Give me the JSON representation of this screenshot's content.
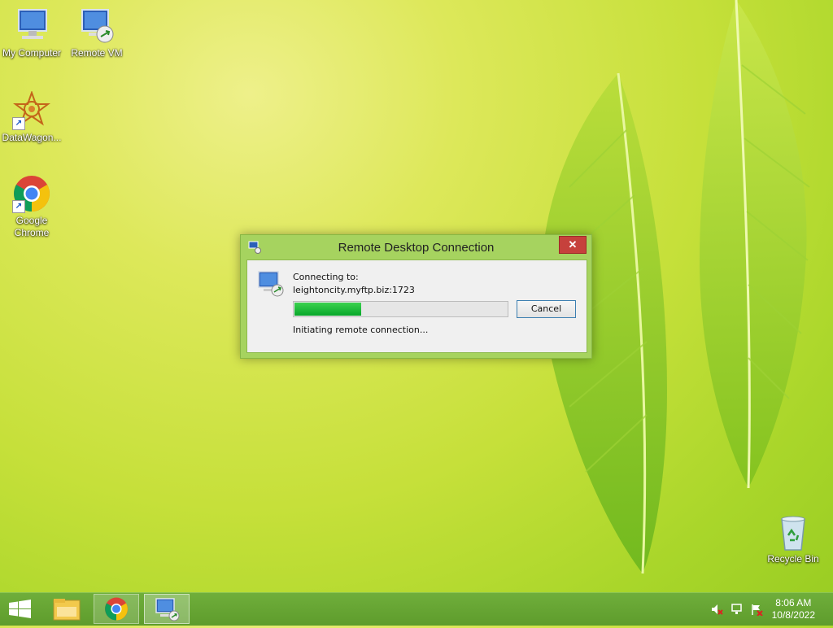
{
  "desktop": {
    "icons": [
      {
        "label": "My Computer"
      },
      {
        "label": "Remote VM"
      },
      {
        "label": "DataWagon..."
      },
      {
        "label": "Google Chrome"
      },
      {
        "label": "Recycle Bin"
      }
    ]
  },
  "dialog": {
    "title": "Remote Desktop Connection",
    "close_label": "✕",
    "connecting_label": "Connecting to:",
    "host": "leightoncity.myftp.biz:1723",
    "progress": 0.32,
    "status": "Initiating remote connection...",
    "cancel_label": "Cancel"
  },
  "taskbar": {
    "time": "8:06 AM",
    "date": "10/8/2022",
    "accent": "#5e9c2c"
  }
}
